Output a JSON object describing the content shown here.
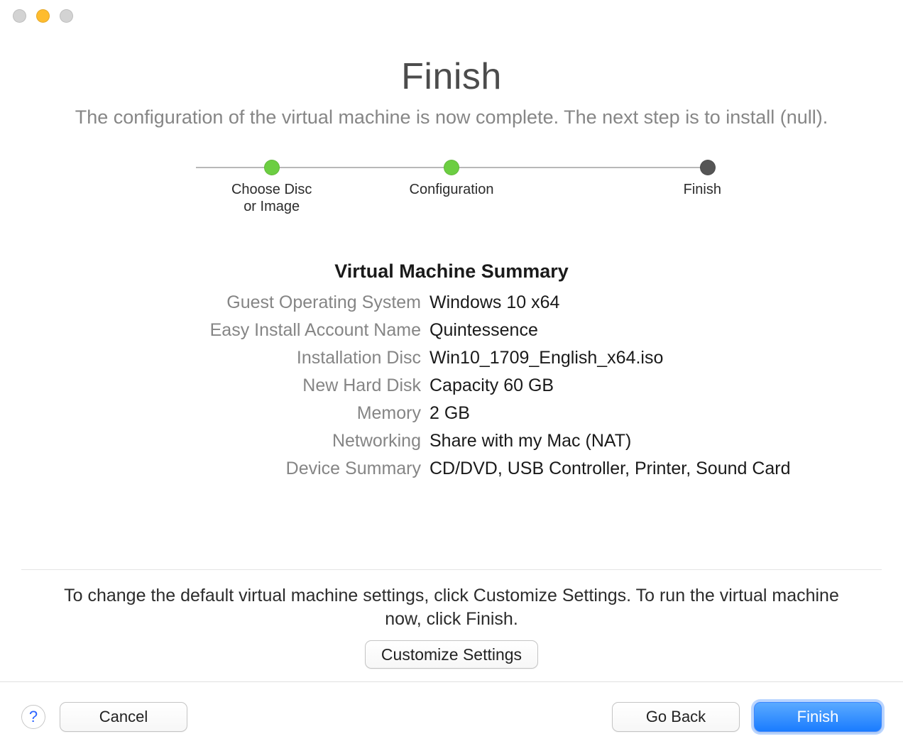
{
  "title": "Finish",
  "subtitle": "The configuration of the virtual machine is now complete.\nThe next step is to install (null).",
  "stepper": {
    "steps": [
      {
        "label": "Choose Disc\nor Image",
        "state": "done"
      },
      {
        "label": "Configuration",
        "state": "done"
      },
      {
        "label": "Finish",
        "state": "current"
      }
    ]
  },
  "summary": {
    "heading": "Virtual Machine Summary",
    "rows": [
      {
        "label": "Guest Operating System",
        "value": "Windows 10 x64"
      },
      {
        "label": "Easy Install Account Name",
        "value": "Quintessence"
      },
      {
        "label": "Installation Disc",
        "value": "Win10_1709_English_x64.iso"
      },
      {
        "label": "New Hard Disk",
        "value": "Capacity 60 GB"
      },
      {
        "label": "Memory",
        "value": "2 GB"
      },
      {
        "label": "Networking",
        "value": "Share with my Mac (NAT)"
      },
      {
        "label": "Device Summary",
        "value": "CD/DVD, USB Controller, Printer, Sound Card"
      }
    ]
  },
  "hint": "To change the default virtual machine settings, click Customize Settings. To run the virtual machine now, click Finish.",
  "buttons": {
    "customize": "Customize Settings",
    "cancel": "Cancel",
    "go_back": "Go Back",
    "finish": "Finish"
  }
}
